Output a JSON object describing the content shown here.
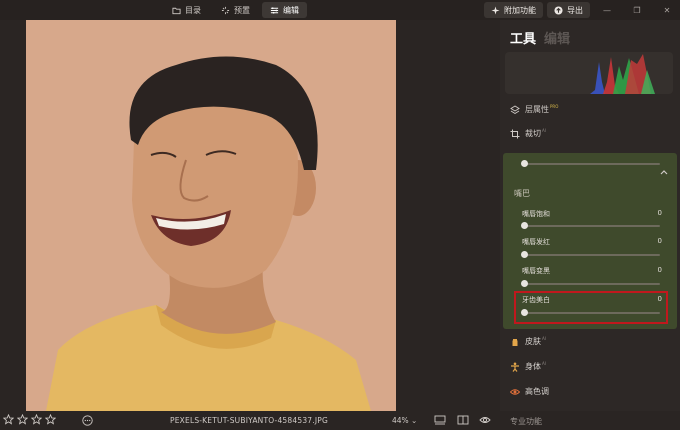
{
  "topbar": {
    "tabs": [
      {
        "label": "目录",
        "icon": "folder-icon"
      },
      {
        "label": "预置",
        "icon": "presets-icon"
      },
      {
        "label": "编辑",
        "icon": "sliders-icon",
        "active": true
      }
    ],
    "addon_label": "附加功能",
    "export_label": "导出"
  },
  "panel": {
    "tools_label": "工具",
    "edit_label": "编辑",
    "layer_props_label": "层属性",
    "layer_badge": "PRO",
    "crop_label": "裁切",
    "crop_badge": "AI",
    "mouth_section": "嘴巴",
    "sliders": [
      {
        "label": "嘴唇饱和",
        "value": "0"
      },
      {
        "label": "嘴唇发红",
        "value": "0"
      },
      {
        "label": "嘴唇变黑",
        "value": "0"
      },
      {
        "label": "牙齿美白",
        "value": "0"
      }
    ],
    "skin_label": "皮肤",
    "skin_badge": "AI",
    "body_label": "身体",
    "body_badge": "AI",
    "color_label": "高色调",
    "pro_functions_label": "专业功能"
  },
  "bottombar": {
    "filename": "PEXELS-KETUT-SUBIYANTO-4584537.JPG",
    "zoom": "44%",
    "rating": 0
  },
  "colors": {
    "accent_red": "#c0181d",
    "panel_green": "#3f4a2c",
    "photo_bg": "#d7a88b"
  }
}
